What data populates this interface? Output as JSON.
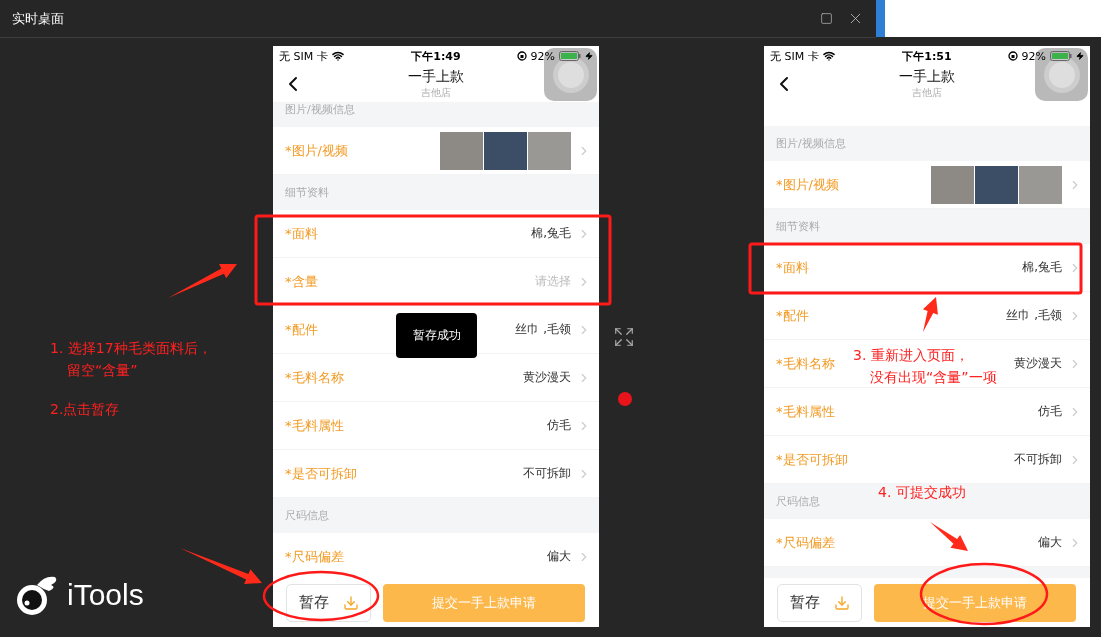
{
  "window": {
    "title": "实时桌面"
  },
  "phones": [
    {
      "status_bar": {
        "carrier": "无 SIM 卡",
        "time": "下午1:49",
        "battery": "92%"
      },
      "nav": {
        "title": "一手上款",
        "subtitle": "吉他店"
      },
      "rows": [
        {
          "kind": "section",
          "label": "图片/视频信息"
        },
        {
          "kind": "photos",
          "label": "*图片/视频"
        },
        {
          "kind": "section",
          "label": "细节资料"
        },
        {
          "kind": "field",
          "label": "*面料",
          "value": "棉,兔毛"
        },
        {
          "kind": "field",
          "label": "*含量",
          "placeholder": "请选择"
        },
        {
          "kind": "field",
          "label": "*配件",
          "value": "丝巾 ,毛领"
        },
        {
          "kind": "field",
          "label": "*毛料名称",
          "value": "黄沙漫天"
        },
        {
          "kind": "field",
          "label": "*毛料属性",
          "value": "仿毛"
        },
        {
          "kind": "field",
          "label": "*是否可拆卸",
          "value": "不可拆卸"
        },
        {
          "kind": "section",
          "label": "尺码信息"
        },
        {
          "kind": "field",
          "label": "*尺码偏差",
          "value": "偏大"
        }
      ],
      "toast": "暂存成功",
      "save_button": "暂存",
      "submit_button": "提交一手上款申请"
    },
    {
      "status_bar": {
        "carrier": "无 SIM 卡",
        "time": "下午1:51",
        "battery": "92%"
      },
      "nav": {
        "title": "一手上款",
        "subtitle": "吉他店"
      },
      "rows": [
        {
          "kind": "section",
          "label": "图片/视频信息"
        },
        {
          "kind": "photos",
          "label": "*图片/视频"
        },
        {
          "kind": "section",
          "label": "细节资料"
        },
        {
          "kind": "field",
          "label": "*面料",
          "value": "棉,兔毛"
        },
        {
          "kind": "field",
          "label": "*配件",
          "value": "丝巾 ,毛领"
        },
        {
          "kind": "field",
          "label": "*毛料名称",
          "value": "黄沙漫天"
        },
        {
          "kind": "field",
          "label": "*毛料属性",
          "value": "仿毛"
        },
        {
          "kind": "field",
          "label": "*是否可拆卸",
          "value": "不可拆卸"
        },
        {
          "kind": "section",
          "label": "尺码信息"
        },
        {
          "kind": "field",
          "label": "*尺码偏差",
          "value": "偏大"
        }
      ],
      "save_button": "暂存",
      "submit_button": "提交一手上款申请"
    }
  ],
  "notes": [
    {
      "lines": [
        "1. 选择17种毛类面料后，",
        "留空“含量”"
      ]
    },
    {
      "lines": [
        "2.点击暂存"
      ]
    },
    {
      "lines": [
        "3. 重新进入页面，",
        "没有出现“含量”一项"
      ]
    },
    {
      "lines": [
        "4. 可提交成功"
      ]
    }
  ],
  "brand": "iTools"
}
